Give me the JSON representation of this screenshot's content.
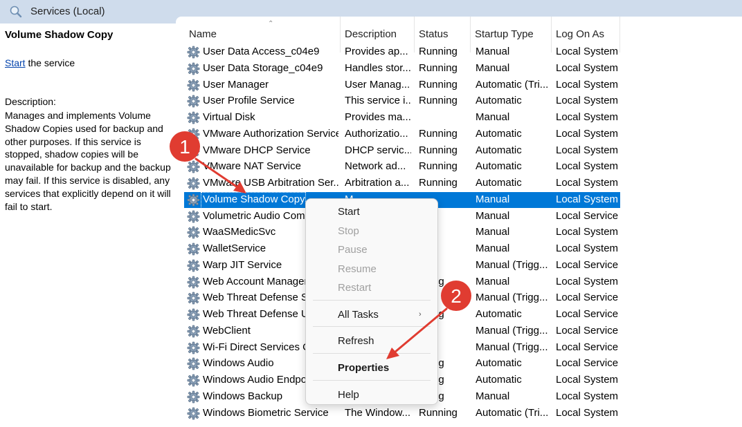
{
  "window": {
    "title": "Services (Local)"
  },
  "left_pane": {
    "service_title": "Volume Shadow Copy",
    "start_link": "Start",
    "start_suffix": " the service",
    "description_label": "Description:",
    "description": "Manages and implements Volume Shadow Copies used for backup and other purposes. If this service is stopped, shadow copies will be unavailable for backup and the backup may fail. If this service is disabled, any services that explicitly depend on it will fail to start."
  },
  "columns": [
    "Name",
    "Description",
    "Status",
    "Startup Type",
    "Log On As"
  ],
  "rows": [
    [
      "User Data Access_c04e9",
      "Provides ap...",
      "Running",
      "Manual",
      "Local System"
    ],
    [
      "User Data Storage_c04e9",
      "Handles stor...",
      "Running",
      "Manual",
      "Local System"
    ],
    [
      "User Manager",
      "User Manag...",
      "Running",
      "Automatic (Tri...",
      "Local System"
    ],
    [
      "User Profile Service",
      "This service i...",
      "Running",
      "Automatic",
      "Local System"
    ],
    [
      "Virtual Disk",
      "Provides ma...",
      "",
      "Manual",
      "Local System"
    ],
    [
      "VMware Authorization Service",
      "Authorizatio...",
      "Running",
      "Automatic",
      "Local System"
    ],
    [
      "VMware DHCP Service",
      "DHCP servic...",
      "Running",
      "Automatic",
      "Local System"
    ],
    [
      "VMware NAT Service",
      "Network ad...",
      "Running",
      "Automatic",
      "Local System"
    ],
    [
      "VMware USB Arbitration Ser...",
      "Arbitration a...",
      "Running",
      "Automatic",
      "Local System"
    ],
    [
      "Volume Shadow Copy",
      "M",
      "",
      "Manual",
      "Local System"
    ],
    [
      "Volumetric Audio Comp",
      "",
      "",
      "Manual",
      "Local Service"
    ],
    [
      "WaaSMedicSvc",
      "",
      "",
      "Manual",
      "Local System"
    ],
    [
      "WalletService",
      "",
      "",
      "Manual",
      "Local System"
    ],
    [
      "Warp JIT Service",
      "",
      "",
      "Manual (Trigg...",
      "Local Service"
    ],
    [
      "Web Account Manager",
      "",
      "nning",
      "Manual",
      "Local System"
    ],
    [
      "Web Threat Defense Se",
      "",
      "",
      "Manual (Trigg...",
      "Local Service"
    ],
    [
      "Web Threat Defense Us",
      "",
      "nning",
      "Automatic",
      "Local Service"
    ],
    [
      "WebClient",
      "",
      "",
      "Manual (Trigg...",
      "Local Service"
    ],
    [
      "Wi-Fi Direct Services Co",
      "",
      "",
      "Manual (Trigg...",
      "Local Service"
    ],
    [
      "Windows Audio",
      "",
      "nning",
      "Automatic",
      "Local Service"
    ],
    [
      "Windows Audio Endpo",
      "",
      "nning",
      "Automatic",
      "Local System"
    ],
    [
      "Windows Backup",
      "",
      "nning",
      "Manual",
      "Local System"
    ],
    [
      "Windows Biometric Service",
      "The Window...",
      "Running",
      "Automatic (Tri...",
      "Local System"
    ]
  ],
  "selected_row": 9,
  "context_menu": {
    "start": "Start",
    "stop": "Stop",
    "pause": "Pause",
    "resume": "Resume",
    "restart": "Restart",
    "all_tasks": "All Tasks",
    "refresh": "Refresh",
    "properties": "Properties",
    "help": "Help"
  },
  "annotations": {
    "badge1": "1",
    "badge2": "2",
    "color": "#e03c31"
  },
  "colors": {
    "selection": "#0078d7",
    "titlebar": "#cfdcec",
    "link": "#0645ad"
  },
  "icons": {
    "title": "services-magnifier-icon",
    "row": "gear-icon"
  }
}
